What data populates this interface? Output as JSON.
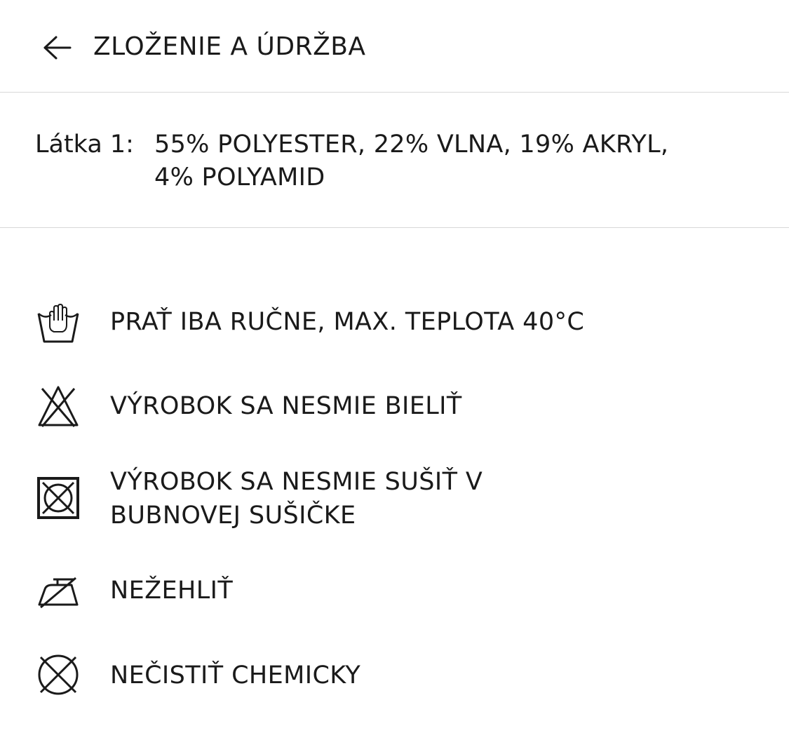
{
  "header": {
    "back_icon": "arrow-left-icon",
    "title": "ZLOŽENIE A ÚDRŽBA"
  },
  "composition": {
    "label": "Látka 1:",
    "line1": "55% POLYESTER, 22% VLNA, 19% AKRYL,",
    "line2": "4% POLYAMID"
  },
  "care": [
    {
      "icon": "hand-wash-icon",
      "text": "PRAŤ IBA RUČNE, MAX. TEPLOTA 40°C"
    },
    {
      "icon": "do-not-bleach-icon",
      "text": "VÝROBOK SA NESMIE BIELIŤ"
    },
    {
      "icon": "do-not-tumble-dry-icon",
      "text_line1": "VÝROBOK SA NESMIE SUŠIŤ V",
      "text_line2": "BUBNOVEJ SUŠIČKE"
    },
    {
      "icon": "do-not-iron-icon",
      "text": "NEŽEHLIŤ"
    },
    {
      "icon": "do-not-dry-clean-icon",
      "text": "NEČISTIŤ CHEMICKY"
    }
  ]
}
